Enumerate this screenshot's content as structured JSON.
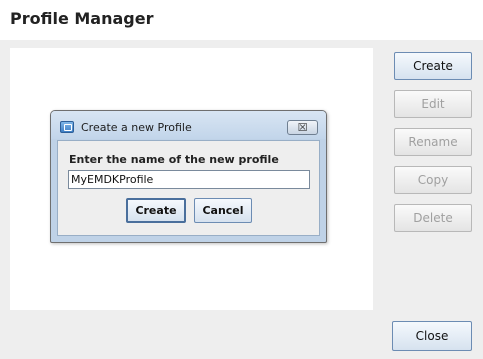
{
  "window": {
    "title": "Profile Manager"
  },
  "actions": {
    "create": "Create",
    "edit": "Edit",
    "rename": "Rename",
    "copy": "Copy",
    "delete": "Delete",
    "close": "Close"
  },
  "dialog": {
    "title": "Create a new Profile",
    "close_glyph": "☒",
    "prompt": "Enter the name of the new profile",
    "input_value": "MyEMDKProfile",
    "create_label": "Create",
    "cancel_label": "Cancel",
    "icon": "window-app-icon"
  },
  "colors": {
    "accent_border": "#6c8cb3",
    "disabled_text": "#a0a0a0",
    "dialog_frame": "#bfd2e7"
  }
}
